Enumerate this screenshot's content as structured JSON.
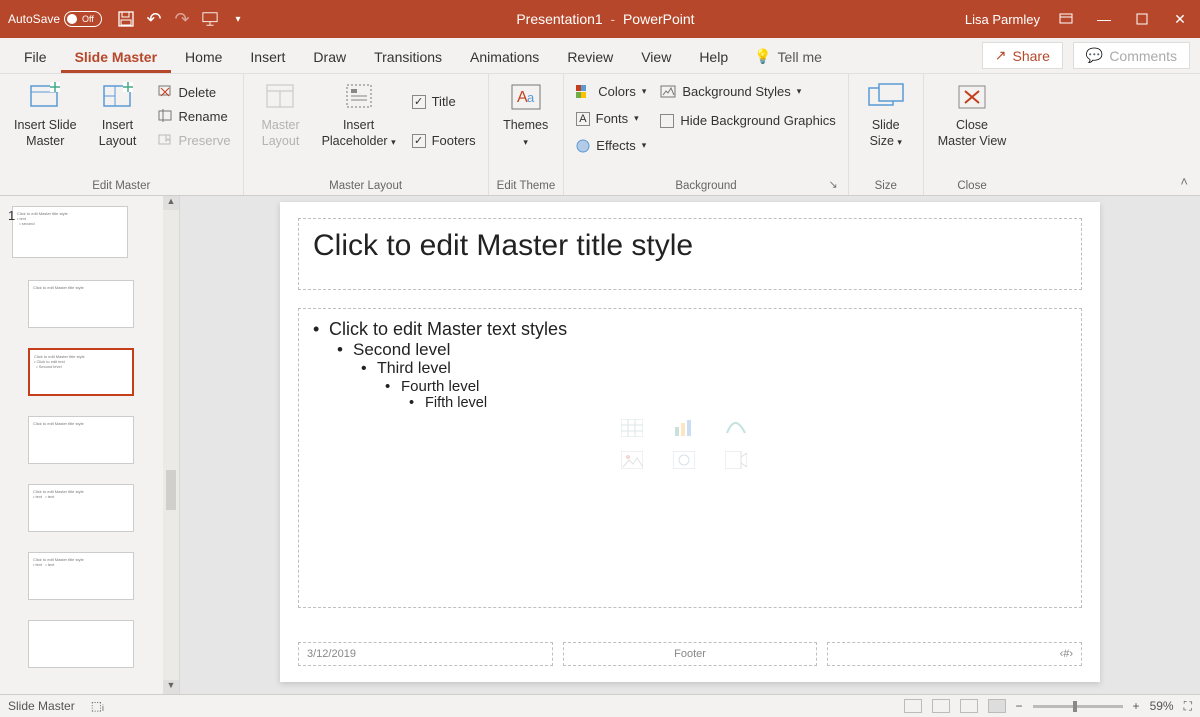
{
  "titlebar": {
    "autosave_label": "AutoSave",
    "autosave_state": "Off",
    "doc_title": "Presentation1",
    "app_name": "PowerPoint",
    "user": "Lisa Parmley"
  },
  "tabs": {
    "items": [
      "File",
      "Slide Master",
      "Home",
      "Insert",
      "Draw",
      "Transitions",
      "Animations",
      "Review",
      "View",
      "Help"
    ],
    "active": "Slide Master",
    "tellme": "Tell me",
    "share": "Share",
    "comments": "Comments"
  },
  "ribbon": {
    "edit_master": {
      "insert_slide_master": "Insert Slide\nMaster",
      "insert_layout": "Insert\nLayout",
      "delete": "Delete",
      "rename": "Rename",
      "preserve": "Preserve",
      "label": "Edit Master"
    },
    "master_layout": {
      "master_layout": "Master\nLayout",
      "insert_placeholder": "Insert\nPlaceholder",
      "title": "Title",
      "footers": "Footers",
      "label": "Master Layout"
    },
    "edit_theme": {
      "themes": "Themes",
      "label": "Edit Theme"
    },
    "background": {
      "colors": "Colors",
      "fonts": "Fonts",
      "effects": "Effects",
      "bg_styles": "Background Styles",
      "hide_bg": "Hide Background Graphics",
      "label": "Background"
    },
    "size": {
      "slide_size": "Slide\nSize",
      "label": "Size"
    },
    "close": {
      "close_mv": "Close\nMaster View",
      "label": "Close"
    }
  },
  "slide": {
    "title": "Click to edit Master title style",
    "l1": "Click to edit Master text styles",
    "l2": "Second level",
    "l3": "Third level",
    "l4": "Fourth level",
    "l5": "Fifth level",
    "date": "3/12/2019",
    "footer": "Footer",
    "num": "‹#›"
  },
  "status": {
    "mode": "Slide Master",
    "zoom": "59%"
  },
  "thumbs": {
    "slidenum": "1"
  }
}
